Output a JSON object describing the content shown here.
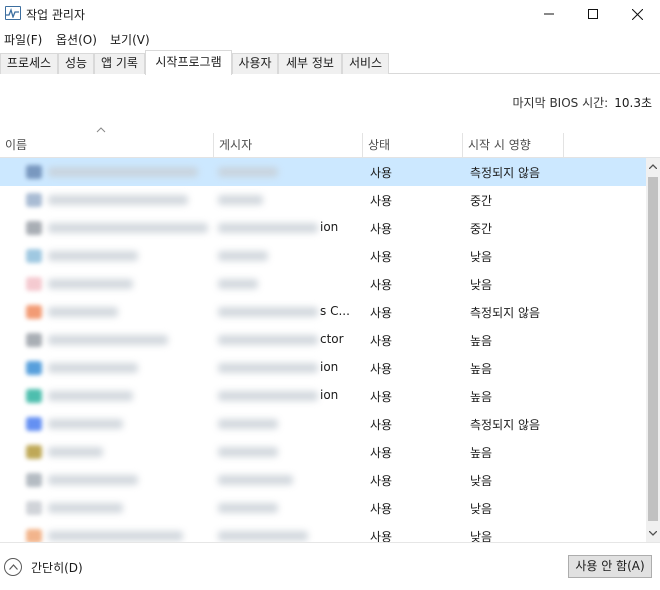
{
  "window": {
    "title": "작업 관리자"
  },
  "menu": [
    "파일(F)",
    "옵션(O)",
    "보기(V)"
  ],
  "tabs": [
    "프로세스",
    "성능",
    "앱 기록",
    "시작프로그램",
    "사용자",
    "세부 정보",
    "서비스"
  ],
  "active_tab_index": 3,
  "bios": {
    "label": "마지막 BIOS 시간:",
    "value": "10.3초"
  },
  "columns": {
    "name": "이름",
    "publisher": "게시자",
    "status": "상태",
    "impact": "시작 시 영향"
  },
  "rows": [
    {
      "publisher_tail": "",
      "status": "사용",
      "impact": "측정되지 않음",
      "icon_color": "#6b8bb5",
      "selected": true
    },
    {
      "publisher_tail": "",
      "status": "사용",
      "impact": "중간",
      "icon_color": "#9ab0cc",
      "selected": false
    },
    {
      "publisher_tail": "ion",
      "status": "사용",
      "impact": "중간",
      "icon_color": "#9aa0a8",
      "selected": false
    },
    {
      "publisher_tail": "",
      "status": "사용",
      "impact": "낮음",
      "icon_color": "#8fbfdc",
      "selected": false
    },
    {
      "publisher_tail": "",
      "status": "사용",
      "impact": "낮음",
      "icon_color": "#f3c1c8",
      "selected": false
    },
    {
      "publisher_tail": "s C...",
      "status": "사용",
      "impact": "측정되지 않음",
      "icon_color": "#f08a5d",
      "selected": false
    },
    {
      "publisher_tail": "ctor",
      "status": "사용",
      "impact": "높음",
      "icon_color": "#9aa0a8",
      "selected": false
    },
    {
      "publisher_tail": "ion",
      "status": "사용",
      "impact": "높음",
      "icon_color": "#3a8fd6",
      "selected": false
    },
    {
      "publisher_tail": "ion",
      "status": "사용",
      "impact": "높음",
      "icon_color": "#2fb3a0",
      "selected": false
    },
    {
      "publisher_tail": "",
      "status": "사용",
      "impact": "측정되지 않음",
      "icon_color": "#4a7df0",
      "selected": false
    },
    {
      "publisher_tail": "",
      "status": "사용",
      "impact": "높음",
      "icon_color": "#b49a3a",
      "selected": false
    },
    {
      "publisher_tail": "",
      "status": "사용",
      "impact": "낮음",
      "icon_color": "#a8b0b8",
      "selected": false
    },
    {
      "publisher_tail": "",
      "status": "사용",
      "impact": "낮음",
      "icon_color": "#c8ccd2",
      "selected": false
    },
    {
      "publisher_tail": "",
      "status": "사용",
      "impact": "낮음",
      "icon_color": "#f0a878",
      "selected": false
    }
  ],
  "footer": {
    "fewer_details": "간단히(D)",
    "disable_button": "사용 안 함(A)"
  },
  "colors": {
    "selection": "#cce8ff",
    "border": "#d9d9d9"
  }
}
